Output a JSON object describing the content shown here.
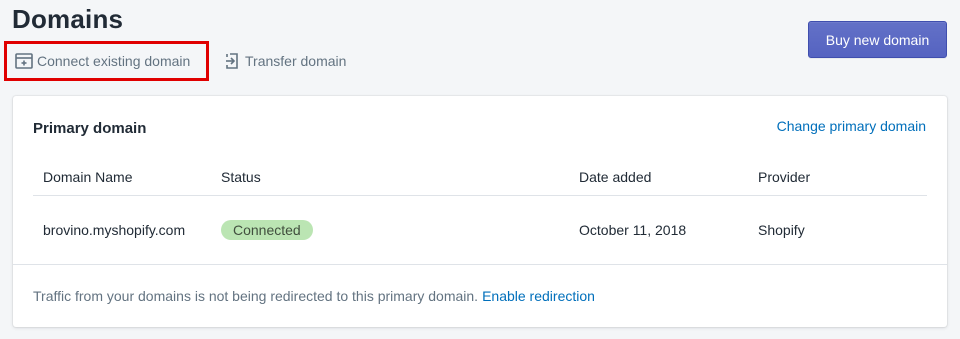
{
  "page": {
    "title": "Domains"
  },
  "actions": {
    "connect_label": "Connect existing domain",
    "transfer_label": "Transfer domain"
  },
  "buy_button": {
    "label": "Buy new domain"
  },
  "primary_domain": {
    "title": "Primary domain",
    "change_link": "Change primary domain",
    "columns": [
      "Domain Name",
      "Status",
      "Date added",
      "Provider"
    ],
    "rows": [
      {
        "domain": "brovino.myshopify.com",
        "status": "Connected",
        "date_added": "October 11, 2018",
        "provider": "Shopify"
      }
    ],
    "footer_text": "Traffic from your domains is not being redirected to this primary domain.",
    "footer_link": "Enable redirection"
  },
  "colors": {
    "accent": "#5c6ac4",
    "link": "#006fbb",
    "highlight_box": "#e00000",
    "status_badge_bg": "#bbe5b3"
  }
}
